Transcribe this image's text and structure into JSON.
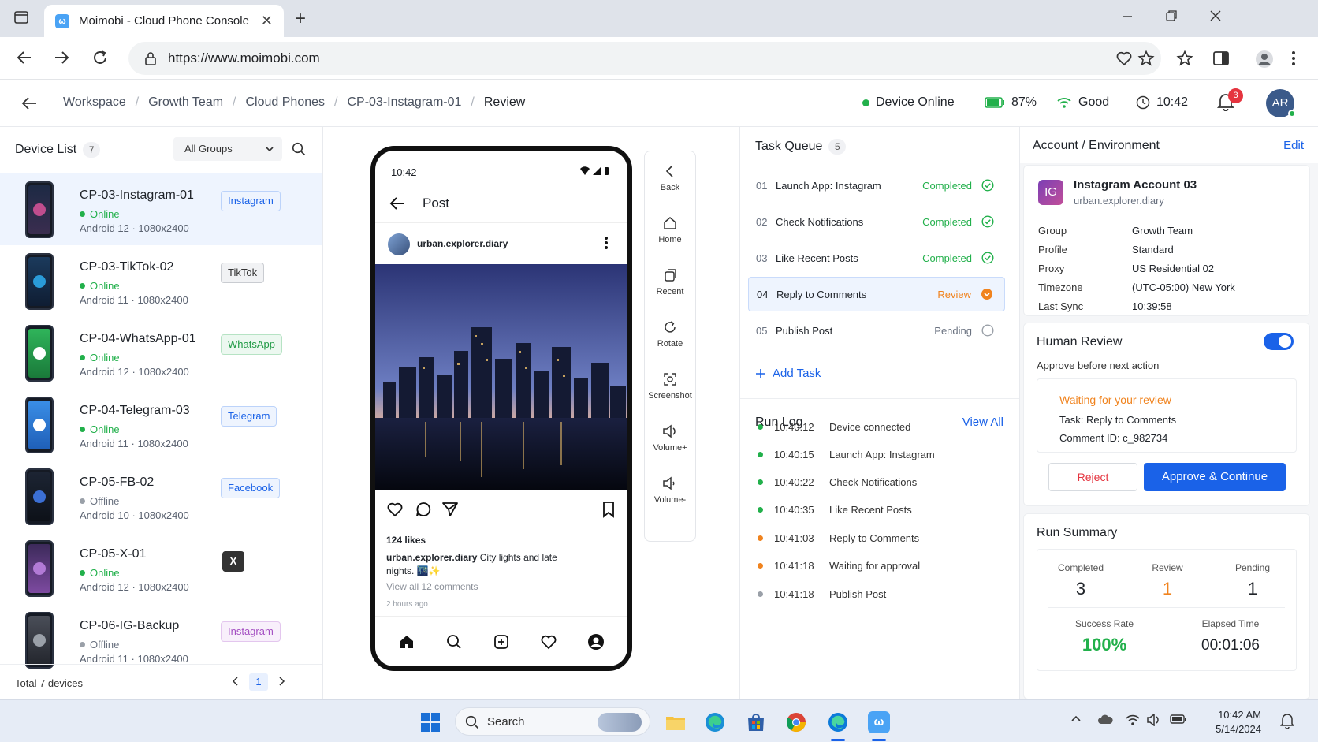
{
  "browser": {
    "tab_title": "Moimobi - Cloud Phone Console",
    "tab_close": "✕",
    "url": "https://www.moimobi.com"
  },
  "breadcrumb": {
    "items": [
      "Workspace",
      "Growth Team",
      "Cloud Phones",
      "CP-03-Instagram-01",
      "Review"
    ]
  },
  "header_status": {
    "device": "Device Online",
    "battery": "87%",
    "signal": "Good",
    "time": "10:42",
    "notifications": "3",
    "avatar": "AR"
  },
  "device_list": {
    "title": "Device List",
    "count": "7",
    "group_filter": "All Groups",
    "devices": [
      {
        "name": "CP-03-Instagram-01",
        "status": "Online",
        "spec": "Android 12 · 1080x2400",
        "tag": "Instagram"
      },
      {
        "name": "CP-03-TikTok-02",
        "status": "Online",
        "spec": "Android 11 · 1080x2400",
        "tag": "TikTok"
      },
      {
        "name": "CP-04-WhatsApp-01",
        "status": "Online",
        "spec": "Android 12 · 1080x2400",
        "tag": "WhatsApp"
      },
      {
        "name": "CP-04-Telegram-03",
        "status": "Online",
        "spec": "Android 11 · 1080x2400",
        "tag": "Telegram"
      },
      {
        "name": "CP-05-FB-02",
        "status": "Offline",
        "spec": "Android 10 · 1080x2400",
        "tag": "Facebook"
      },
      {
        "name": "CP-05-X-01",
        "status": "Online",
        "spec": "Android 12 · 1080x2400",
        "tag": "X"
      },
      {
        "name": "CP-06-IG-Backup",
        "status": "Offline",
        "spec": "Android 11 · 1080x2400",
        "tag": "Instagram"
      }
    ],
    "total": "Total 7 devices",
    "page": "1"
  },
  "phone": {
    "time": "10:42",
    "screen_title": "Post",
    "post_user": "urban.explorer.diary",
    "likes": "124 likes",
    "caption_user": "urban.explorer.diary",
    "caption_text": "City lights and late nights. 🌃✨",
    "comments_link": "View all 12 comments",
    "posted_ago": "2 hours ago"
  },
  "controls": {
    "back": "Back",
    "home": "Home",
    "recent": "Recent",
    "rotate": "Rotate",
    "screenshot": "Screenshot",
    "volume_up": "Volume+",
    "volume_down": "Volume-"
  },
  "task_queue": {
    "title": "Task Queue",
    "count": "5",
    "tasks": [
      {
        "num": "01",
        "name": "Launch App: Instagram",
        "status": "Completed"
      },
      {
        "num": "02",
        "name": "Check Notifications",
        "status": "Completed"
      },
      {
        "num": "03",
        "name": "Like Recent Posts",
        "status": "Completed"
      },
      {
        "num": "04",
        "name": "Reply to Comments",
        "status": "Review"
      },
      {
        "num": "05",
        "name": "Publish Post",
        "status": "Pending"
      }
    ],
    "add_task": "Add Task"
  },
  "run_log": {
    "title": "Run Log",
    "view_all": "View All",
    "entries": [
      {
        "time": "10:40:12",
        "event": "Device connected",
        "color": "#22b04b"
      },
      {
        "time": "10:40:15",
        "event": "Launch App: Instagram",
        "color": "#22b04b"
      },
      {
        "time": "10:40:22",
        "event": "Check Notifications",
        "color": "#22b04b"
      },
      {
        "time": "10:40:35",
        "event": "Like Recent Posts",
        "color": "#22b04b"
      },
      {
        "time": "10:41:03",
        "event": "Reply to Comments",
        "color": "#f0831e"
      },
      {
        "time": "10:41:18",
        "event": "Waiting for approval",
        "color": "#f0831e"
      },
      {
        "time": "10:41:18",
        "event": "Publish Post",
        "color": "#9aa0a8"
      }
    ]
  },
  "account": {
    "title": "Account / Environment",
    "edit": "Edit",
    "logo_text": "IG",
    "name": "Instagram Account 03",
    "username": "urban.explorer.diary",
    "fields": [
      {
        "key": "Group",
        "value": "Growth Team"
      },
      {
        "key": "Profile",
        "value": "Standard"
      },
      {
        "key": "Proxy",
        "value": "US Residential 02"
      },
      {
        "key": "Timezone",
        "value": "(UTC-05:00) New York"
      },
      {
        "key": "Last Sync",
        "value": "10:39:58"
      }
    ]
  },
  "human_review": {
    "title": "Human Review",
    "enabled": true,
    "subtitle": "Approve before next action",
    "waiting": "Waiting for your review",
    "task": "Task: Reply to Comments",
    "comment_id": "Comment ID: c_982734",
    "reject": "Reject",
    "approve": "Approve & Continue"
  },
  "run_summary": {
    "title": "Run Summary",
    "completed_label": "Completed",
    "completed": "3",
    "review_label": "Review",
    "review": "1",
    "pending_label": "Pending",
    "pending": "1",
    "success_label": "Success Rate",
    "success": "100%",
    "elapsed_label": "Elapsed Time",
    "elapsed": "00:01:06"
  },
  "taskbar": {
    "search": "Search",
    "time": "10:42 AM",
    "date": "5/14/2024"
  },
  "colors": {
    "accent": "#1a62e8",
    "online": "#22b04b",
    "review": "#f0831e",
    "danger": "#e5343f"
  }
}
